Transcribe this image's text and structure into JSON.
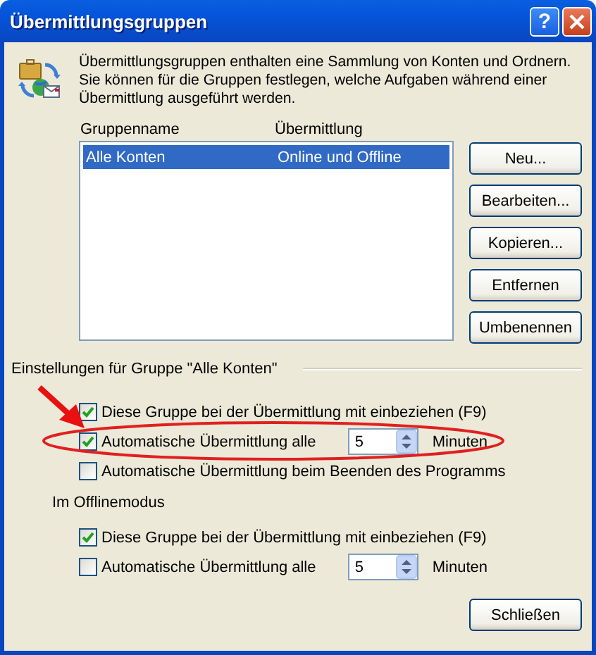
{
  "window": {
    "title": "Übermittlungsgruppen",
    "help_button": "?"
  },
  "description": "Übermittlungsgruppen enthalten eine Sammlung von Konten und Ordnern. Sie können für die Gruppen festlegen, welche Aufgaben während einer Übermittlung ausgeführt werden.",
  "groups_list": {
    "columns": [
      "Gruppenname",
      "Übermittlung"
    ],
    "rows": [
      {
        "cells": [
          "Alle Konten",
          "Online und Offline"
        ],
        "selected": true
      }
    ]
  },
  "side_buttons": [
    "Neu...",
    "Bearbeiten...",
    "Kopieren...",
    "Entfernen",
    "Umbenennen"
  ],
  "group_settings": {
    "label": "Einstellungen für Gruppe \"Alle Konten\"",
    "options": [
      {
        "kind": "check",
        "label": "Diese Gruppe bei der Übermittlung mit einbeziehen (F9)",
        "checked": true
      },
      {
        "kind": "interval",
        "label": "Automatische Übermittlung alle",
        "checked": true,
        "value": "5",
        "unit": "Minuten"
      },
      {
        "kind": "check",
        "label": "Automatische Übermittlung beim Beenden des Programms",
        "checked": false
      }
    ]
  },
  "offline_settings": {
    "label": "Im Offlinemodus",
    "options": [
      {
        "kind": "check",
        "label": "Diese Gruppe bei der Übermittlung mit einbeziehen (F9)",
        "checked": true
      },
      {
        "kind": "interval",
        "label": "Automatische Übermittlung alle",
        "checked": false,
        "value": "5",
        "unit": "Minuten"
      }
    ]
  },
  "close_button": "Schließen"
}
